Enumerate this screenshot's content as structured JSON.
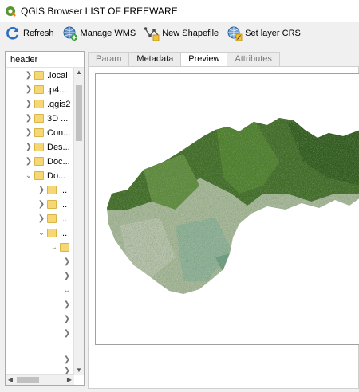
{
  "window": {
    "title": "QGIS Browser  LIST OF FREEWARE"
  },
  "toolbar": {
    "refresh_label": "Refresh",
    "manage_wms_label": "Manage WMS",
    "new_shapefile_label": "New Shapefile",
    "set_crs_label": "Set layer CRS"
  },
  "tree": {
    "header": "header",
    "items": [
      {
        "label": ".local",
        "expanded": false
      },
      {
        "label": ".p4...",
        "expanded": false
      },
      {
        "label": ".qgis2",
        "expanded": false
      },
      {
        "label": "3D ...",
        "expanded": false
      },
      {
        "label": "Con...",
        "expanded": false
      },
      {
        "label": "Des...",
        "expanded": false
      },
      {
        "label": "Doc...",
        "expanded": false
      },
      {
        "label": "Do...",
        "expanded": true
      },
      {
        "label": "...",
        "expanded": false
      },
      {
        "label": "...",
        "expanded": false
      },
      {
        "label": "...",
        "expanded": false
      },
      {
        "label": "...",
        "expanded": true
      },
      {
        "label": "",
        "expanded": true
      }
    ]
  },
  "tabs": [
    "Param",
    "Metadata",
    "Preview",
    "Attributes"
  ],
  "active_tab": "Preview",
  "colors": {
    "folder": "#f6d776",
    "map_forest": "#3f6b26",
    "map_lowland": "#a7b89a",
    "map_accent": "#b0a3c4"
  }
}
